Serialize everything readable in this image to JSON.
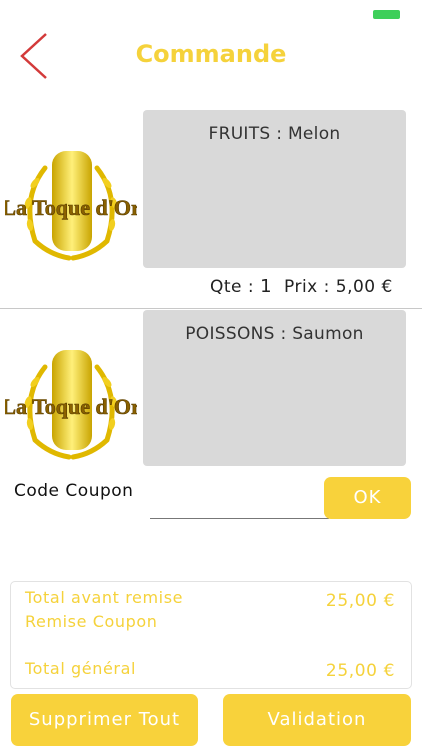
{
  "header": {
    "title": "Commande"
  },
  "brand": {
    "logo_text": "La Toque d'Or"
  },
  "items": [
    {
      "description": "FRUITS : Melon",
      "qty_label": "Qte :",
      "qty_value": "1",
      "price_label": "Prix :",
      "price_value": "5,00 €"
    },
    {
      "description": "POISSONS : Saumon"
    }
  ],
  "coupon": {
    "label": "Code Coupon",
    "value": "",
    "ok_label": "OK"
  },
  "totals": {
    "before_discount_label": "Total avant remise",
    "before_discount_value": "25,00 €",
    "coupon_discount_label": "Remise Coupon",
    "grand_total_label": "Total général",
    "grand_total_value": "25,00 €"
  },
  "actions": {
    "delete_all_label": "Supprimer Tout",
    "validate_label": "Validation"
  },
  "colors": {
    "accent": "#f8d23b",
    "back_arrow": "#d33a3a",
    "battery": "#3ecf5a"
  }
}
